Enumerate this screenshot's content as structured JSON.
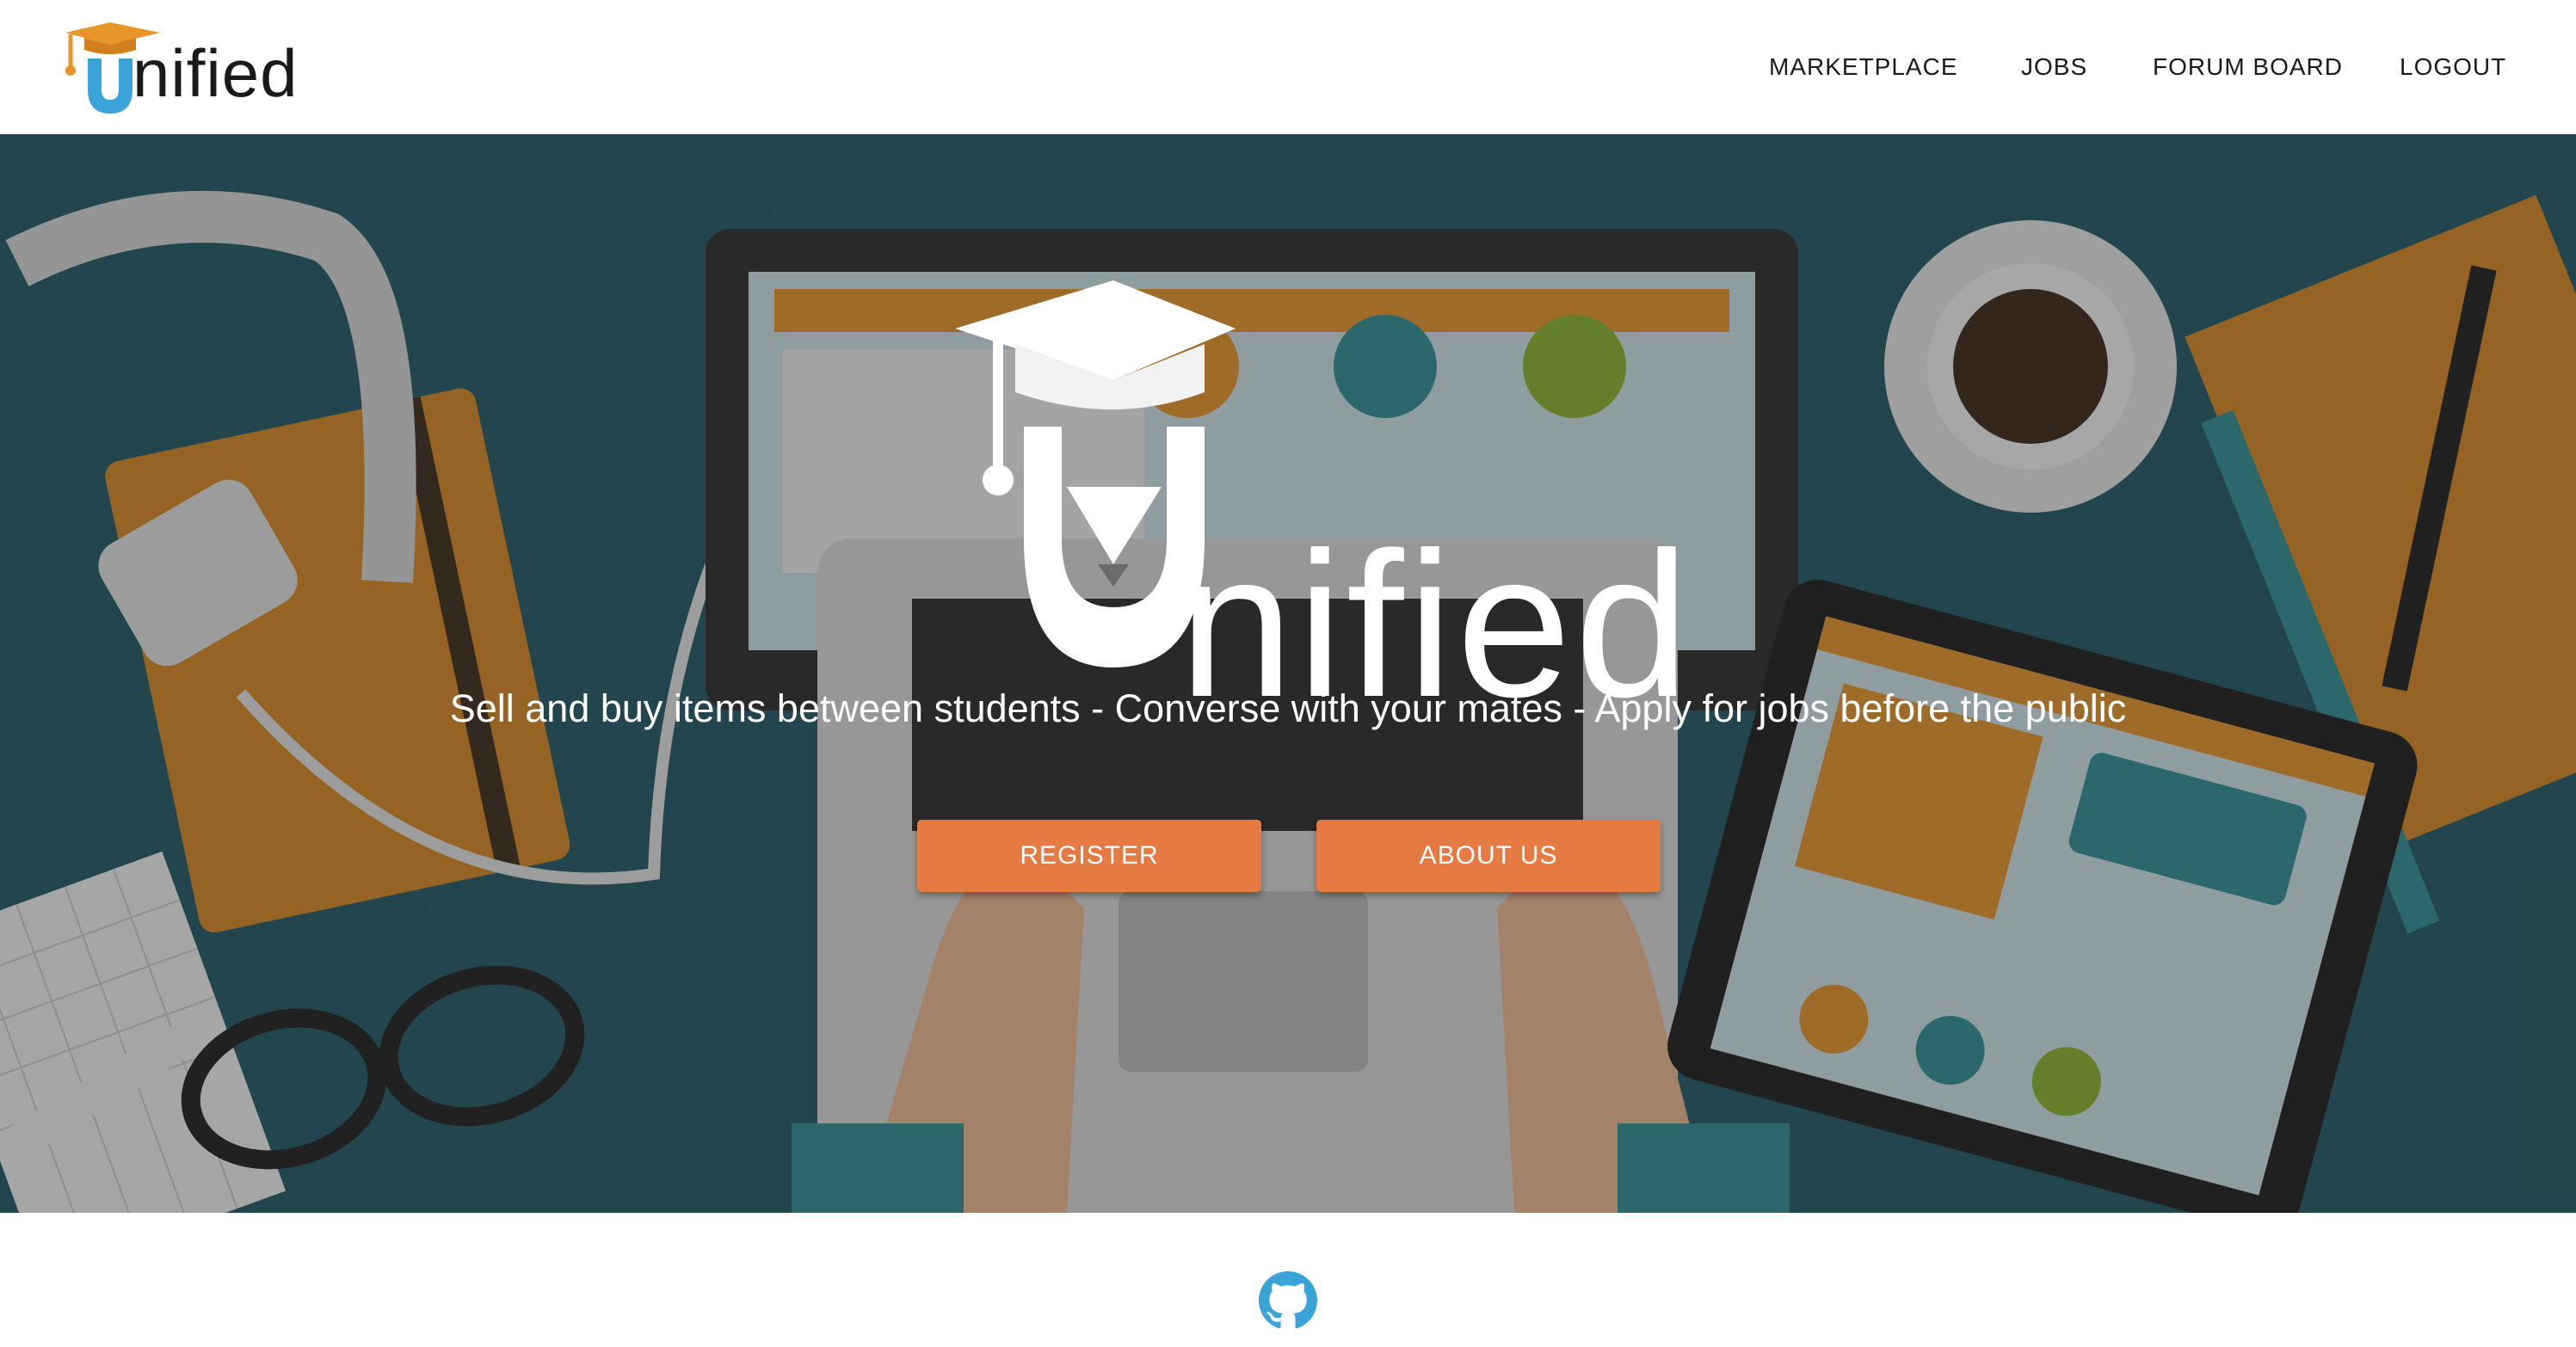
{
  "header": {
    "logo_text": "nified",
    "nav": [
      {
        "label": "MARKETPLACE"
      },
      {
        "label": "JOBS"
      },
      {
        "label": "FORUM BOARD"
      },
      {
        "label": "LOGOUT"
      }
    ]
  },
  "hero": {
    "logo_text": "nified",
    "tagline": "Sell and buy items between students - Converse with your mates - Apply for jobs before the public",
    "buttons": {
      "register": "REGISTER",
      "about": "ABOUT US"
    }
  },
  "colors": {
    "accent_orange": "#e67a43",
    "logo_blue": "#3aa3d8",
    "cap_orange": "#e8952a",
    "hero_teal": "#1f5560",
    "github_blue": "#3aa3d8"
  },
  "footer": {
    "icon": "github-icon"
  }
}
